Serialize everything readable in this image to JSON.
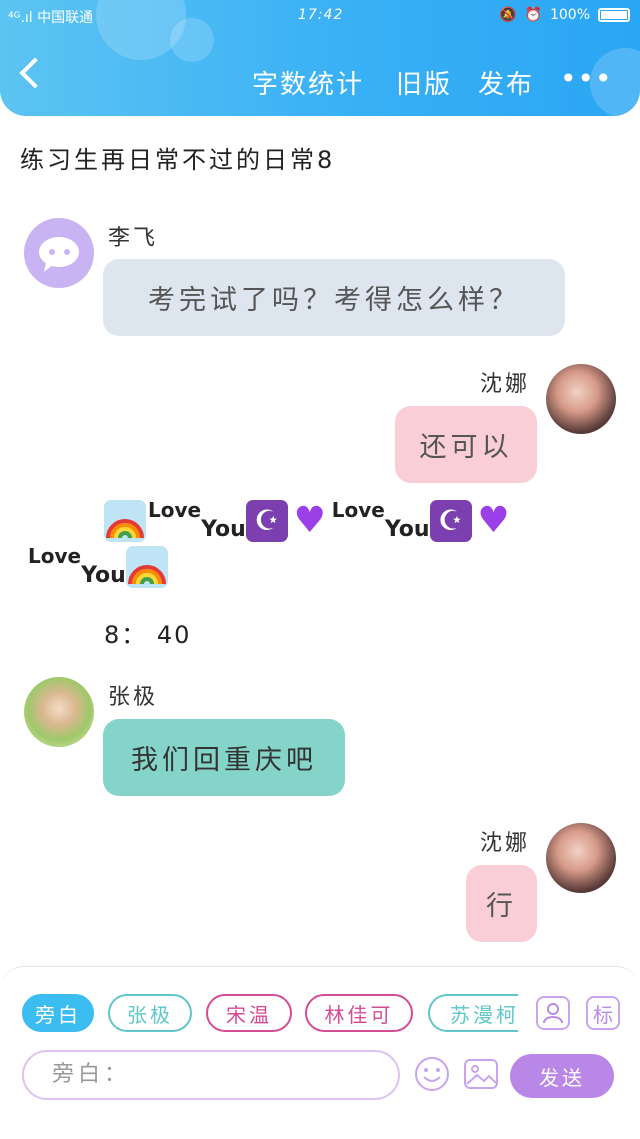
{
  "status": {
    "carrier": "⁴ᴳ.ıl 中国联通",
    "time": "17:42",
    "battery": "100%"
  },
  "header": {
    "word_count": "字数统计",
    "old_version": "旧版",
    "publish": "发布"
  },
  "story_title": "练习生再日常不过的日常8",
  "messages": [
    {
      "speaker": "李飞",
      "text": "考完试了吗？考得怎么样？",
      "color": "#dde5ee"
    },
    {
      "speaker": "沈娜",
      "text": "还可以",
      "color": "#f9ced6"
    },
    {
      "speaker": "张极",
      "text": "我们回重庆吧",
      "color": "#85d4c9"
    },
    {
      "speaker": "沈娜",
      "text": "行",
      "color": "#f9ced6"
    }
  ],
  "emoji_text": {
    "love": "Love",
    "you": "You"
  },
  "time_text": "8： 40",
  "roles": [
    {
      "label": "旁白",
      "color": "#3bbdf1"
    },
    {
      "label": "张极",
      "color": "#5fc7c7"
    },
    {
      "label": "宋温",
      "color": "#d44c93"
    },
    {
      "label": "林佳可",
      "color": "#d44c93"
    },
    {
      "label": "苏漫柯",
      "color": "#5fc7c7"
    }
  ],
  "mark_label": "标",
  "input": {
    "placeholder": "旁白："
  },
  "send_label": "发送"
}
